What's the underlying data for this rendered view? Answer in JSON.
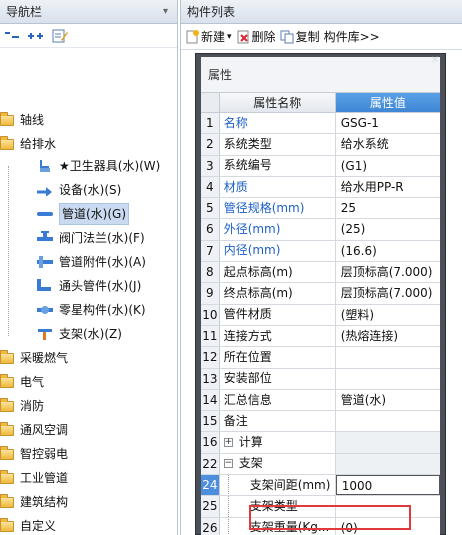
{
  "nav": {
    "title": "导航栏",
    "tree": [
      {
        "label": "轴线",
        "level": 0,
        "icon": "folder-icon"
      },
      {
        "label": "给排水",
        "level": 0,
        "icon": "folder-icon"
      },
      {
        "label": "★卫生器具(水)(W)",
        "level": 1,
        "icon": "sanitary-fixture-icon"
      },
      {
        "label": "设备(水)(S)",
        "level": 1,
        "icon": "equipment-icon"
      },
      {
        "label": "管道(水)(G)",
        "level": 1,
        "icon": "pipe-icon",
        "selected": true
      },
      {
        "label": "阀门法兰(水)(F)",
        "level": 1,
        "icon": "valve-icon"
      },
      {
        "label": "管道附件(水)(A)",
        "level": 1,
        "icon": "pipe-fitting-icon"
      },
      {
        "label": "通头管件(水)(J)",
        "level": 1,
        "icon": "tee-fitting-icon"
      },
      {
        "label": "零星构件(水)(K)",
        "level": 1,
        "icon": "misc-component-icon"
      },
      {
        "label": "支架(水)(Z)",
        "level": 1,
        "icon": "bracket-icon"
      },
      {
        "label": "采暖燃气",
        "level": 0,
        "icon": "folder-icon"
      },
      {
        "label": "电气",
        "level": 0,
        "icon": "folder-icon"
      },
      {
        "label": "消防",
        "level": 0,
        "icon": "folder-icon"
      },
      {
        "label": "通风空调",
        "level": 0,
        "icon": "folder-icon"
      },
      {
        "label": "智控弱电",
        "level": 0,
        "icon": "folder-icon"
      },
      {
        "label": "工业管道",
        "level": 0,
        "icon": "folder-icon"
      },
      {
        "label": "建筑结构",
        "level": 0,
        "icon": "folder-icon"
      },
      {
        "label": "自定义",
        "level": 0,
        "icon": "folder-icon"
      }
    ]
  },
  "components": {
    "title": "构件列表",
    "toolbar": {
      "new_label": "新建",
      "delete_label": "删除",
      "copy_label": "复制",
      "library_label": "构件库>>"
    }
  },
  "properties": {
    "title": "属性",
    "col_name": "属性名称",
    "col_value": "属性值",
    "rows": [
      {
        "idx": "1",
        "name": "名称",
        "value": "GSG-1",
        "blue": true
      },
      {
        "idx": "2",
        "name": "系统类型",
        "value": "给水系统"
      },
      {
        "idx": "3",
        "name": "系统编号",
        "value": "(G1)"
      },
      {
        "idx": "4",
        "name": "材质",
        "value": "给水用PP-R",
        "blue": true
      },
      {
        "idx": "5",
        "name": "管径规格(mm)",
        "value": "25",
        "blue": true
      },
      {
        "idx": "6",
        "name": "外径(mm)",
        "value": "(25)",
        "blue": true
      },
      {
        "idx": "7",
        "name": "内径(mm)",
        "value": "(16.6)",
        "blue": true
      },
      {
        "idx": "8",
        "name": "起点标高(m)",
        "value": "层顶标高(7.000)"
      },
      {
        "idx": "9",
        "name": "终点标高(m)",
        "value": "层顶标高(7.000)"
      },
      {
        "idx": "10",
        "name": "管件材质",
        "value": "(塑料)"
      },
      {
        "idx": "11",
        "name": "连接方式",
        "value": "(热熔连接)"
      },
      {
        "idx": "12",
        "name": "所在位置",
        "value": ""
      },
      {
        "idx": "13",
        "name": "安装部位",
        "value": ""
      },
      {
        "idx": "14",
        "name": "汇总信息",
        "value": "管道(水)"
      },
      {
        "idx": "15",
        "name": "备注",
        "value": ""
      },
      {
        "idx": "16",
        "name": "计算",
        "value": "",
        "group": true,
        "expander": "+"
      },
      {
        "idx": "22",
        "name": "支架",
        "value": "",
        "group": true,
        "expander": "−"
      },
      {
        "idx": "24",
        "name": "支架间距(mm)",
        "value": "1000",
        "sub": true,
        "selected": true
      },
      {
        "idx": "25",
        "name": "支架类型",
        "value": "",
        "sub": true
      },
      {
        "idx": "26",
        "name": "支架重量(Kg...",
        "value": "(0)",
        "sub": true
      }
    ]
  },
  "colors": {
    "header_blue": "#4a8fdc",
    "link_blue": "#1d5fc7",
    "highlight_red": "#e03a3a",
    "selection": "#c9daf1"
  }
}
